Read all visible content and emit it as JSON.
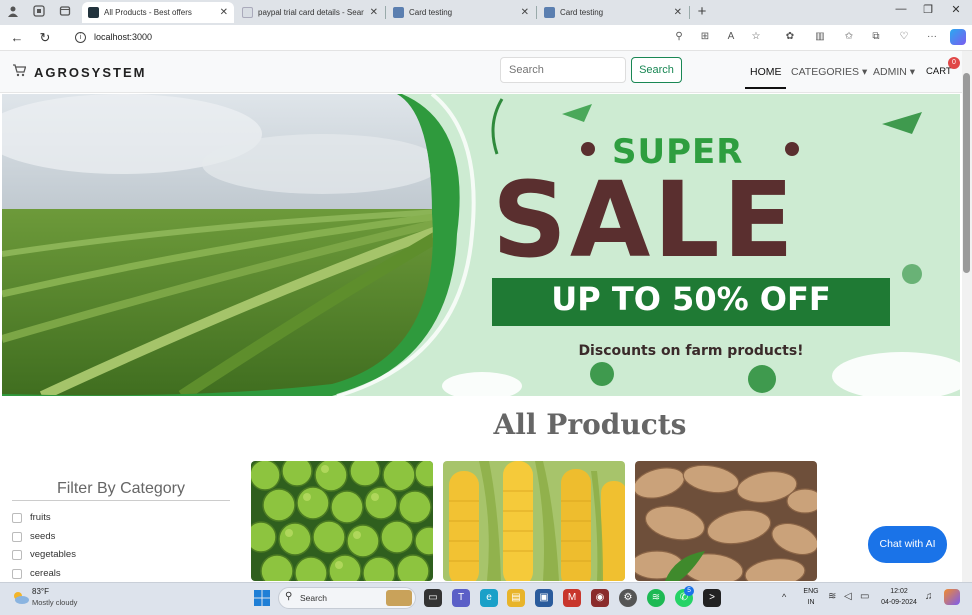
{
  "browser": {
    "tabs": [
      {
        "title": "All Products - Best offers",
        "active": true
      },
      {
        "title": "paypal trial card details - Search",
        "active": false
      },
      {
        "title": "Card testing",
        "active": false
      },
      {
        "title": "Card testing",
        "active": false
      }
    ],
    "url": "localhost:3000",
    "win_minimize": "—",
    "win_restore": "❐",
    "win_close": "✕"
  },
  "site": {
    "brand": "AGROSYSTEM",
    "search_placeholder": "Search",
    "search_button": "Search",
    "nav": {
      "home": "HOME",
      "categories": "CATEGORIES ▾",
      "admin": "ADMIN ▾",
      "cart": "CART",
      "cart_count": "0"
    }
  },
  "banner": {
    "super": "SUPER",
    "sale": "SALE",
    "offer": "UP TO 50% OFF",
    "tagline": "Discounts on farm products!"
  },
  "products": {
    "heading": "All Products",
    "filter_title": "Filter By Category",
    "categories": [
      "fruits",
      "seeds",
      "vegetables",
      "cereals"
    ],
    "cards": [
      "limes",
      "corn",
      "ginger"
    ]
  },
  "chat": {
    "label": "Chat with AI"
  },
  "taskbar": {
    "weather_temp": "83°F",
    "weather_desc": "Mostly cloudy",
    "search_label": "Search",
    "lang": "ENG",
    "region": "IN",
    "time": "12:02",
    "date": "04-09-2024",
    "notify_badge": "5"
  },
  "colors": {
    "accent_green": "#198754",
    "banner_green": "#2e9e3f",
    "sale_brown": "#5a2f2f",
    "chat_blue": "#1a73e8"
  }
}
